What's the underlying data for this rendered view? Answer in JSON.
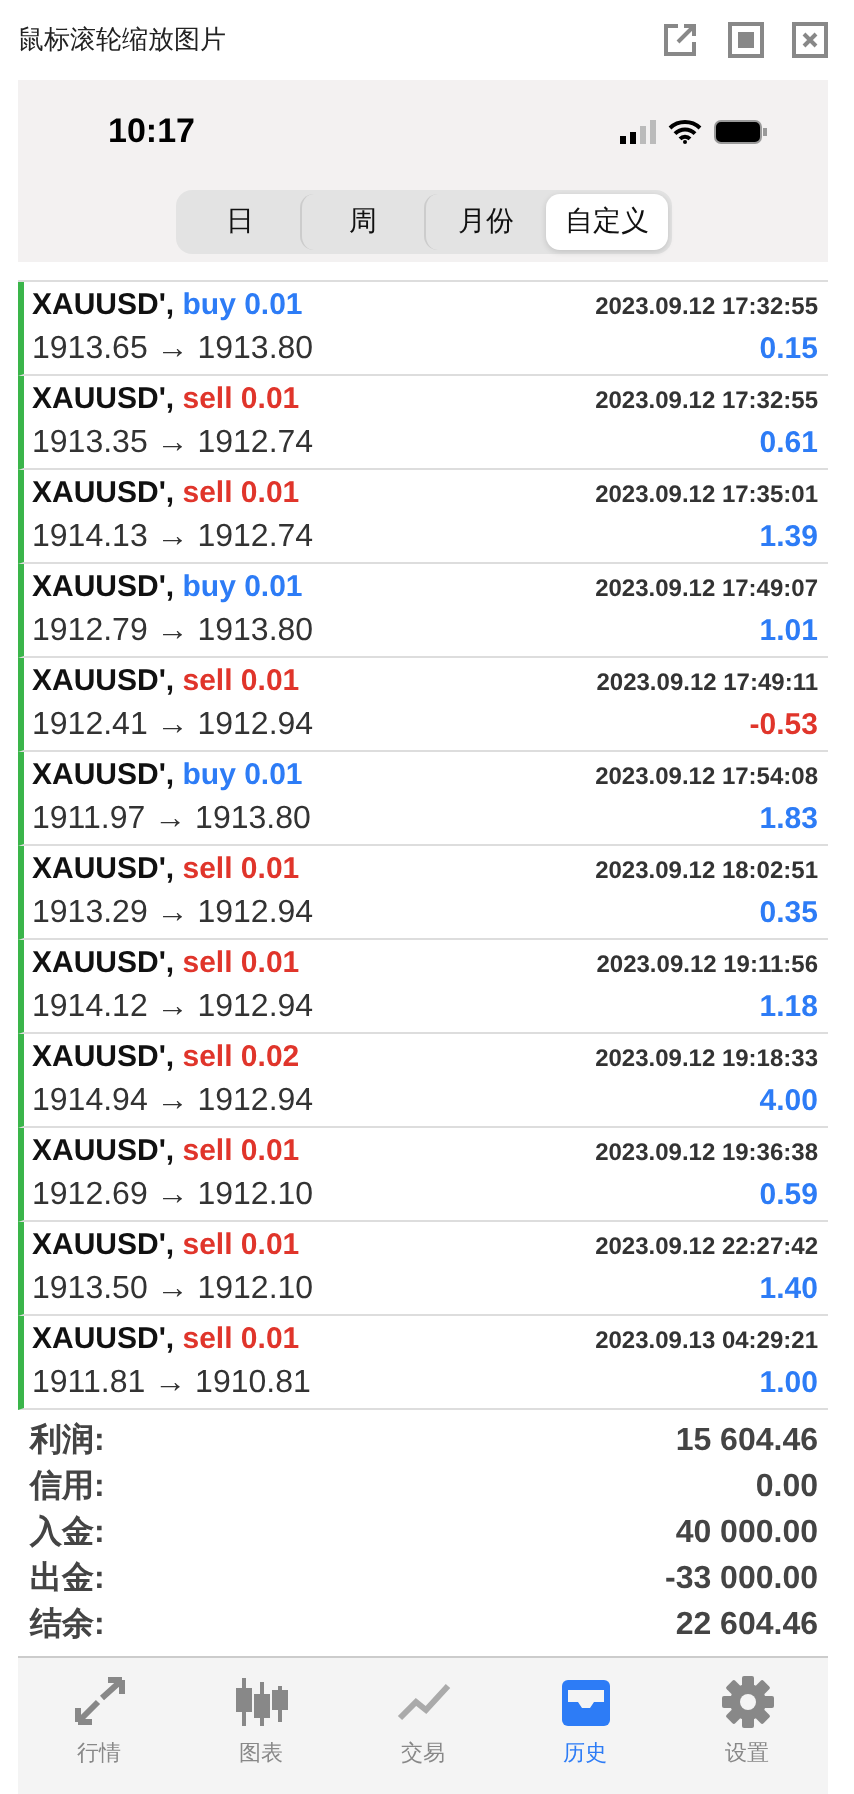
{
  "window": {
    "title": "鼠标滚轮缩放图片"
  },
  "status_bar": {
    "time": "10:17"
  },
  "tabs": [
    {
      "label": "日",
      "selected": false
    },
    {
      "label": "周",
      "selected": false
    },
    {
      "label": "月份",
      "selected": false
    },
    {
      "label": "自定义",
      "selected": true
    }
  ],
  "trades": [
    {
      "symbol": "XAUUSD',",
      "type": "buy",
      "volume": "0.01",
      "time": "2023.09.12 17:32:55",
      "prices": "1913.65 → 1913.80",
      "profit": "0.15",
      "loss": false
    },
    {
      "symbol": "XAUUSD',",
      "type": "sell",
      "volume": "0.01",
      "time": "2023.09.12 17:32:55",
      "prices": "1913.35 → 1912.74",
      "profit": "0.61",
      "loss": false
    },
    {
      "symbol": "XAUUSD',",
      "type": "sell",
      "volume": "0.01",
      "time": "2023.09.12 17:35:01",
      "prices": "1914.13 → 1912.74",
      "profit": "1.39",
      "loss": false
    },
    {
      "symbol": "XAUUSD',",
      "type": "buy",
      "volume": "0.01",
      "time": "2023.09.12 17:49:07",
      "prices": "1912.79 → 1913.80",
      "profit": "1.01",
      "loss": false
    },
    {
      "symbol": "XAUUSD',",
      "type": "sell",
      "volume": "0.01",
      "time": "2023.09.12 17:49:11",
      "prices": "1912.41 → 1912.94",
      "profit": "-0.53",
      "loss": true
    },
    {
      "symbol": "XAUUSD',",
      "type": "buy",
      "volume": "0.01",
      "time": "2023.09.12 17:54:08",
      "prices": "1911.97 → 1913.80",
      "profit": "1.83",
      "loss": false
    },
    {
      "symbol": "XAUUSD',",
      "type": "sell",
      "volume": "0.01",
      "time": "2023.09.12 18:02:51",
      "prices": "1913.29 → 1912.94",
      "profit": "0.35",
      "loss": false
    },
    {
      "symbol": "XAUUSD',",
      "type": "sell",
      "volume": "0.01",
      "time": "2023.09.12 19:11:56",
      "prices": "1914.12 → 1912.94",
      "profit": "1.18",
      "loss": false
    },
    {
      "symbol": "XAUUSD',",
      "type": "sell",
      "volume": "0.02",
      "time": "2023.09.12 19:18:33",
      "prices": "1914.94 → 1912.94",
      "profit": "4.00",
      "loss": false
    },
    {
      "symbol": "XAUUSD',",
      "type": "sell",
      "volume": "0.01",
      "time": "2023.09.12 19:36:38",
      "prices": "1912.69 → 1912.10",
      "profit": "0.59",
      "loss": false
    },
    {
      "symbol": "XAUUSD',",
      "type": "sell",
      "volume": "0.01",
      "time": "2023.09.12 22:27:42",
      "prices": "1913.50 → 1912.10",
      "profit": "1.40",
      "loss": false
    },
    {
      "symbol": "XAUUSD',",
      "type": "sell",
      "volume": "0.01",
      "time": "2023.09.13 04:29:21",
      "prices": "1911.81 → 1910.81",
      "profit": "1.00",
      "loss": false
    }
  ],
  "summary": [
    {
      "label": "利润:",
      "value": "15 604.46"
    },
    {
      "label": "信用:",
      "value": "0.00"
    },
    {
      "label": "入金:",
      "value": "40 000.00"
    },
    {
      "label": "出金:",
      "value": "-33 000.00"
    },
    {
      "label": "结余:",
      "value": "22 604.46"
    }
  ],
  "nav": [
    {
      "kind": "quotes",
      "label": "行情",
      "selected": false
    },
    {
      "kind": "chart",
      "label": "图表",
      "selected": false
    },
    {
      "kind": "trade",
      "label": "交易",
      "selected": false
    },
    {
      "kind": "history",
      "label": "历史",
      "selected": true
    },
    {
      "kind": "settings",
      "label": "设置",
      "selected": false
    }
  ]
}
